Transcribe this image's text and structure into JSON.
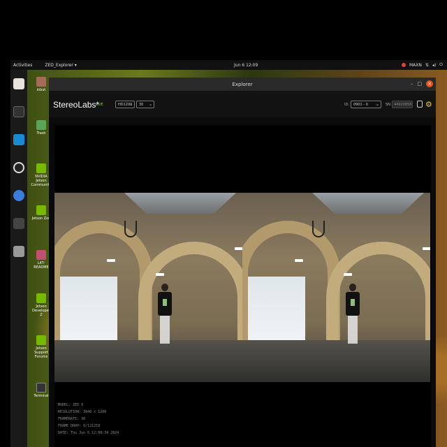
{
  "topbar": {
    "activities": "Activities",
    "app_name": "ZED_Explorer ▾",
    "clock": "Jun 6  12:09",
    "power_mode": "MAXN"
  },
  "desktop": {
    "icons": [
      {
        "label": "inbot",
        "icon": "home-folder-icon"
      },
      {
        "label": "Trash",
        "icon": "trash-icon"
      },
      {
        "label": "NVIDIA Jetson Community",
        "icon": "nvidia-icon"
      },
      {
        "label": "Jetson Zoo",
        "icon": "nvidia-icon"
      },
      {
        "label": "L4T-README",
        "icon": "drive-icon"
      },
      {
        "label": "Jetson Developer Z",
        "icon": "nvidia-icon"
      },
      {
        "label": "Jetson Support Forums",
        "icon": "nvidia-icon"
      },
      {
        "label": "Terminal",
        "icon": "terminal-icon"
      }
    ]
  },
  "window": {
    "title": "Explorer",
    "minimize": "–",
    "maximize": "□",
    "close": "×"
  },
  "toolbar": {
    "brand": "StereoLabs*",
    "live": "LIVE",
    "resolution": "HD1200",
    "fps": "30",
    "id_label": "ID:",
    "id_value": "0901 - 0",
    "sn_label": "SN:",
    "sn_value": "44920858"
  },
  "info": {
    "model": "MODEL: ZED X",
    "resolution": "RESOLUTION: 3840 x 1200",
    "framerate": "FRAMERATE: 30",
    "frame_drop": "FRAME DROP: 0/121258",
    "date": "DATE: Thu Jun 6 12:08:34 2024"
  },
  "colors": {
    "accent": "#7fd13b",
    "close": "#e9541f",
    "gear": "#e8c54a"
  }
}
